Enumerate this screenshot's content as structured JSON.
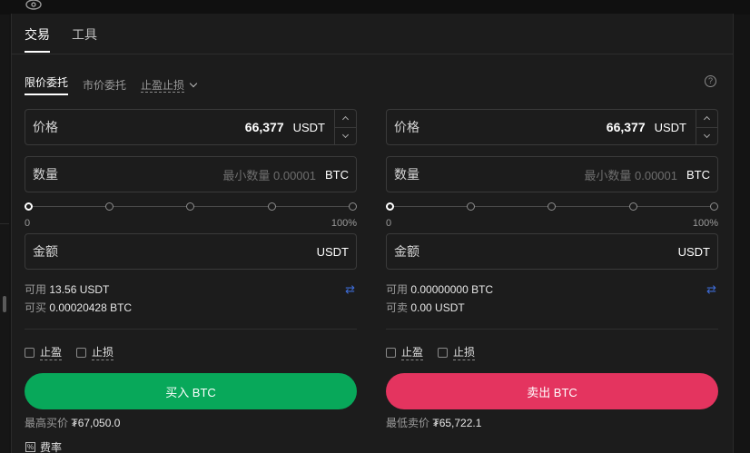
{
  "tabs": [
    {
      "label": "交易",
      "active": true
    },
    {
      "label": "工具",
      "active": false
    }
  ],
  "order_types": {
    "limit": "限价委托",
    "market": "市价委托",
    "tpsl": "止盈止损"
  },
  "buy": {
    "price_label": "价格",
    "price_value": "66,377",
    "price_unit": "USDT",
    "qty_label": "数量",
    "qty_placeholder": "最小数量 0.00001",
    "qty_unit": "BTC",
    "slider_min": "0",
    "slider_max": "100%",
    "slider_value_percent": 0,
    "amount_label": "金额",
    "amount_unit": "USDT",
    "avail_label": "可用",
    "avail_value": "13.56 USDT",
    "can_label": "可买",
    "can_value": "0.00020428 BTC",
    "tp_label": "止盈",
    "sl_label": "止损",
    "button": "买入 BTC",
    "limit_label": "最高买价",
    "limit_value": "₮67,050.0"
  },
  "sell": {
    "price_label": "价格",
    "price_value": "66,377",
    "price_unit": "USDT",
    "qty_label": "数量",
    "qty_placeholder": "最小数量 0.00001",
    "qty_unit": "BTC",
    "slider_min": "0",
    "slider_max": "100%",
    "slider_value_percent": 0,
    "amount_label": "金额",
    "amount_unit": "USDT",
    "avail_label": "可用",
    "avail_value": "0.00000000 BTC",
    "can_label": "可卖",
    "can_value": "0.00 USDT",
    "tp_label": "止盈",
    "sl_label": "止损",
    "button": "卖出 BTC",
    "limit_label": "最低卖价",
    "limit_value": "₮65,722.1"
  },
  "fee_label": "费率",
  "colors": {
    "buy": "#08a85a",
    "sell": "#e4345f",
    "transfer_icon": "#3d6bd6"
  }
}
